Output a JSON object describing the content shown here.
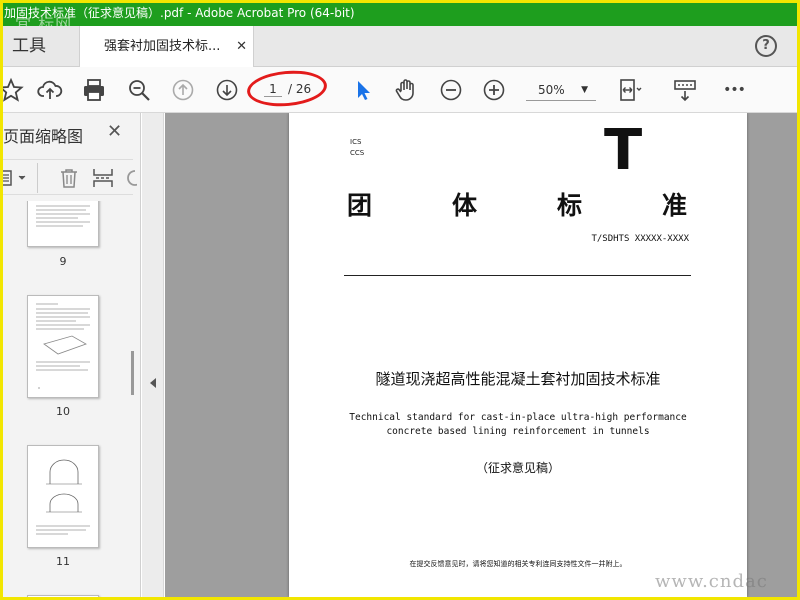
{
  "window": {
    "title": "加固技术标准（征求意见稿）.pdf - Adobe Acrobat Pro (64-bit)",
    "watermark_top": "宜 标网",
    "watermark_bottom": "www.cndac"
  },
  "tabs": {
    "tools_label": "工具",
    "document_label": "强套衬加固技术标...",
    "close_glyph": "✕",
    "help_glyph": "?"
  },
  "toolbar": {
    "current_page": "1",
    "total_pages": "/ 26",
    "zoom_value": "50%",
    "more_glyph": "•••",
    "accent_color": "#1a73e8",
    "highlight_color": "#e31b1b"
  },
  "left_panel": {
    "title": "页面缩略图",
    "close_glyph": "✕",
    "thumbnails": [
      {
        "label": "9"
      },
      {
        "label": "10"
      },
      {
        "label": "11"
      }
    ]
  },
  "page": {
    "ics_label": "ICS",
    "ccs_label": "CCS",
    "category_letter": "T",
    "title_chars": [
      "团",
      "体",
      "标",
      "准"
    ],
    "standard_number": "T/SDHTS  XXXXX-XXXX",
    "zh_title": "隧道现浇超高性能混凝土套衬加固技术标准",
    "en_title_line1": "Technical standard for cast-in-place ultra-high performance",
    "en_title_line2": "concrete based lining reinforcement in tunnels",
    "draft_label": "（征求意见稿）",
    "footnote": "在提交反馈意见时，请将您知道的相关专利连同支持性文件一并附上。"
  }
}
